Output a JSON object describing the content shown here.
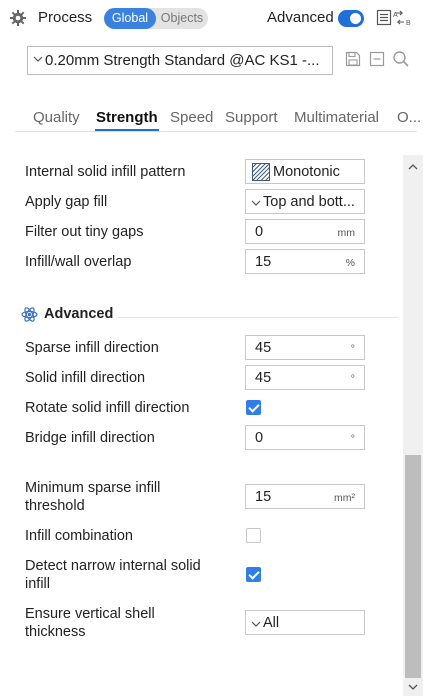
{
  "header": {
    "title": "Process",
    "seg_global": "Global",
    "seg_objects": "Objects",
    "advanced_label": "Advanced",
    "advanced_on": true
  },
  "preset": {
    "value": "0.20mm Strength Standard @AC KS1 -..."
  },
  "tabs": [
    {
      "label": "Quality",
      "active": false
    },
    {
      "label": "Strength",
      "active": true
    },
    {
      "label": "Speed",
      "active": false
    },
    {
      "label": "Support",
      "active": false
    },
    {
      "label": "Multimaterial",
      "active": false
    },
    {
      "label": "O...",
      "active": false
    }
  ],
  "settings": {
    "internal_solid_infill_pattern": {
      "label": "Internal solid infill pattern",
      "value": "Monotonic"
    },
    "apply_gap_fill": {
      "label": "Apply gap fill",
      "value": "Top and bott..."
    },
    "filter_tiny_gaps": {
      "label": "Filter out tiny gaps",
      "value": "0",
      "unit": "mm"
    },
    "infill_wall_overlap": {
      "label": "Infill/wall overlap",
      "value": "15",
      "unit": "%"
    }
  },
  "advanced": {
    "title": "Advanced",
    "sparse_infill_direction": {
      "label": "Sparse infill direction",
      "value": "45",
      "unit": "°"
    },
    "solid_infill_direction": {
      "label": "Solid infill direction",
      "value": "45",
      "unit": "°"
    },
    "rotate_solid_infill_direction": {
      "label": "Rotate solid infill direction",
      "checked": true
    },
    "bridge_infill_direction": {
      "label": "Bridge infill direction",
      "value": "0",
      "unit": "°"
    },
    "min_sparse_infill_threshold": {
      "label_line1": "Minimum sparse infill",
      "label_line2": "threshold",
      "value": "15",
      "unit": "mm²"
    },
    "infill_combination": {
      "label": "Infill combination",
      "checked": false
    },
    "detect_narrow_internal_solid_infill": {
      "label_line1": "Detect narrow internal solid",
      "label_line2": "infill",
      "checked": true
    },
    "ensure_vertical_shell_thickness": {
      "label_line1": "Ensure vertical shell",
      "label_line2": "thickness",
      "value": "All"
    }
  },
  "colors": {
    "accent": "#1e6fd9",
    "checkbox": "#2f7fe6",
    "segment_active": "#3b82e0"
  }
}
